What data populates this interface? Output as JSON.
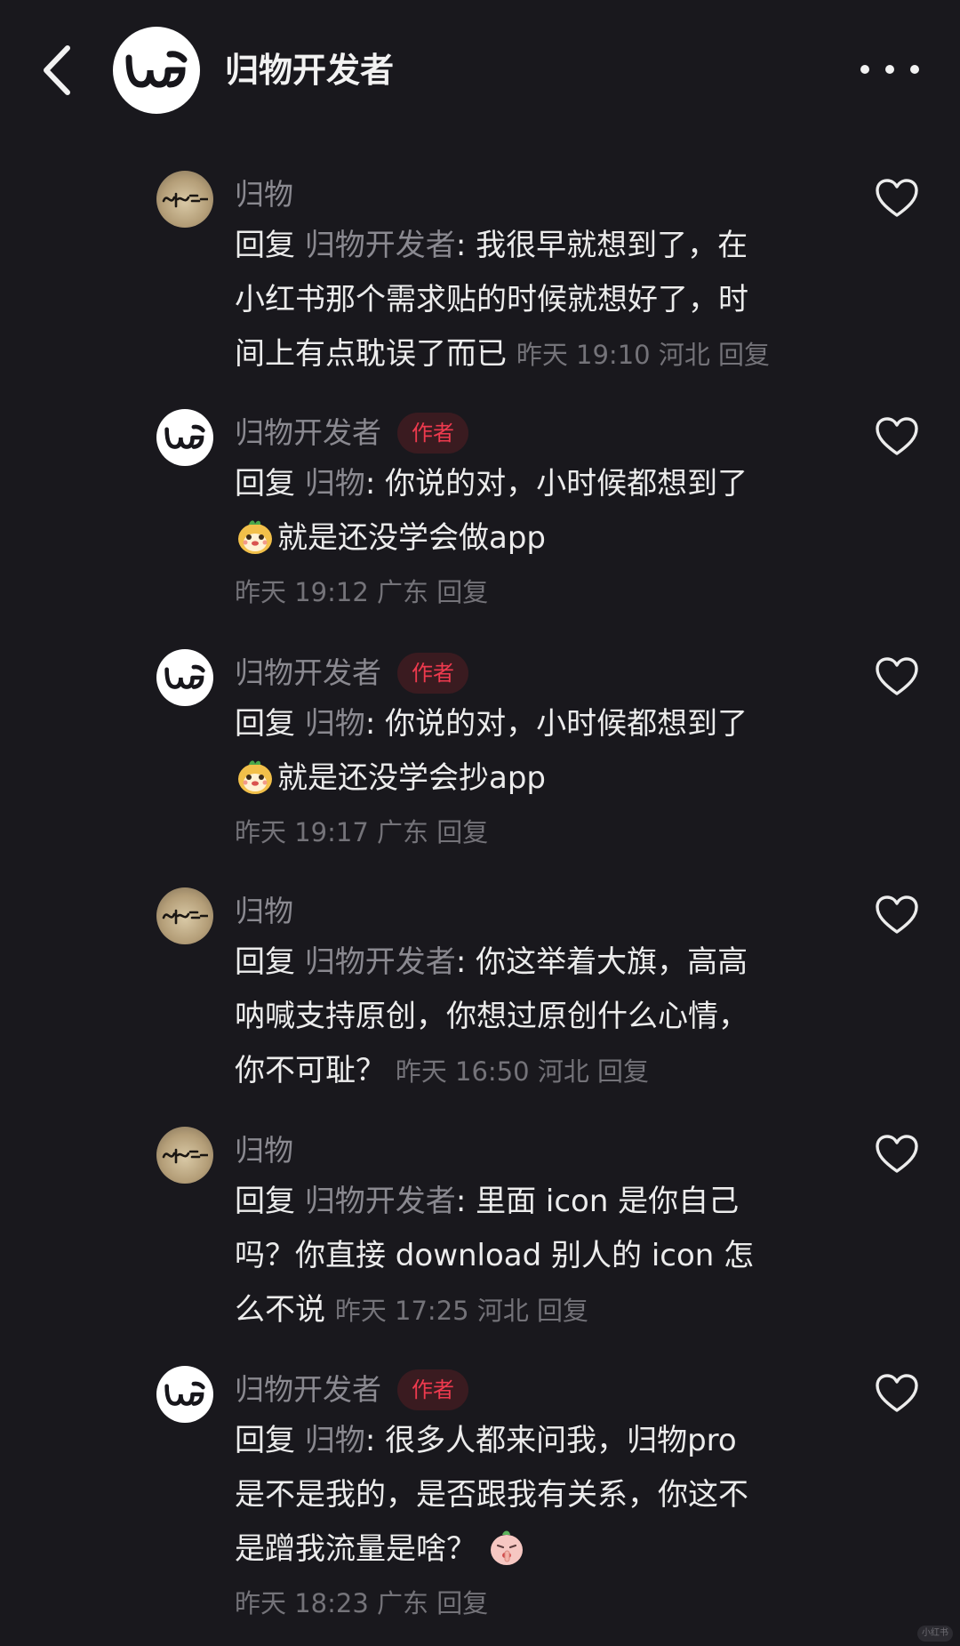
{
  "header": {
    "title": "归物开发者"
  },
  "comments": [
    {
      "name": "归物",
      "is_author": false,
      "lines": [
        [
          {
            "t": "回复 ",
            "c": ""
          },
          {
            "t": "归物开发者",
            "c": "muted"
          },
          {
            "t": ": 我很早就想到了，在",
            "c": ""
          }
        ],
        [
          {
            "t": "小红书那个需求贴的时候就想好了，时",
            "c": ""
          }
        ],
        [
          {
            "t": "间上有点耽误了而已 ",
            "c": ""
          },
          {
            "t": "昨天 19:10 河北 ",
            "c": "meta"
          },
          {
            "t": "回复",
            "c": "meta reply"
          }
        ]
      ]
    },
    {
      "name": "归物开发者",
      "is_author": true,
      "badge": "作者",
      "lines": [
        [
          {
            "t": "回复 ",
            "c": ""
          },
          {
            "t": "归物",
            "c": "muted"
          },
          {
            "t": ": 你说的对，小时候都想到了",
            "c": ""
          }
        ],
        [
          {
            "t": "",
            "c": "emoji-smile"
          },
          {
            "t": "就是还没学会做app",
            "c": ""
          }
        ]
      ],
      "meta": {
        "time": "昨天 19:12",
        "location": "广东",
        "reply": "回复"
      }
    },
    {
      "name": "归物开发者",
      "is_author": true,
      "badge": "作者",
      "lines": [
        [
          {
            "t": "回复 ",
            "c": ""
          },
          {
            "t": "归物",
            "c": "muted"
          },
          {
            "t": ": 你说的对，小时候都想到了",
            "c": ""
          }
        ],
        [
          {
            "t": "",
            "c": "emoji-smile"
          },
          {
            "t": "就是还没学会抄app",
            "c": ""
          }
        ]
      ],
      "meta": {
        "time": "昨天 19:17",
        "location": "广东",
        "reply": "回复"
      }
    },
    {
      "name": "归物",
      "is_author": false,
      "lines": [
        [
          {
            "t": "回复 ",
            "c": ""
          },
          {
            "t": "归物开发者",
            "c": "muted"
          },
          {
            "t": ": 你这举着大旗，高高",
            "c": ""
          }
        ],
        [
          {
            "t": "呐喊支持原创，你想过原创什么心情，",
            "c": ""
          }
        ],
        [
          {
            "t": "你不可耻？ ",
            "c": ""
          },
          {
            "t": "昨天 16:50 河北 ",
            "c": "meta"
          },
          {
            "t": "回复",
            "c": "meta reply"
          }
        ]
      ]
    },
    {
      "name": "归物",
      "is_author": false,
      "lines": [
        [
          {
            "t": "回复 ",
            "c": ""
          },
          {
            "t": "归物开发者",
            "c": "muted"
          },
          {
            "t": ": 里面 icon 是你自己",
            "c": ""
          }
        ],
        [
          {
            "t": "吗？你直接 download 别人的 icon 怎",
            "c": ""
          }
        ],
        [
          {
            "t": "么不说 ",
            "c": ""
          },
          {
            "t": "昨天 17:25 河北 ",
            "c": "meta"
          },
          {
            "t": "回复",
            "c": "meta reply"
          }
        ]
      ]
    },
    {
      "name": "归物开发者",
      "is_author": true,
      "badge": "作者",
      "lines": [
        [
          {
            "t": "回复 ",
            "c": ""
          },
          {
            "t": "归物",
            "c": "muted"
          },
          {
            "t": ": 很多人都来问我，归物pro",
            "c": ""
          }
        ],
        [
          {
            "t": "是不是我的，是否跟我有关系，你这不",
            "c": ""
          }
        ],
        [
          {
            "t": "是蹭我流量是啥？ ",
            "c": ""
          },
          {
            "t": "",
            "c": "emoji-shush"
          }
        ]
      ],
      "meta": {
        "time": "昨天 18:23",
        "location": "广东",
        "reply": "回复"
      }
    }
  ],
  "icons": {
    "back": "chevron-left-icon",
    "more": "more-dots-icon",
    "like": "heart-outline-icon",
    "smile_emoji": "smiling-face-emoji",
    "shush_emoji": "shushing-face-emoji"
  },
  "colors": {
    "background": "#19181d",
    "text": "#ececec",
    "muted": "#8a8990",
    "meta": "#747379",
    "author_badge_text": "#ee3a4e",
    "author_badge_bg": "#3a1b20"
  },
  "watermark": "小红书"
}
